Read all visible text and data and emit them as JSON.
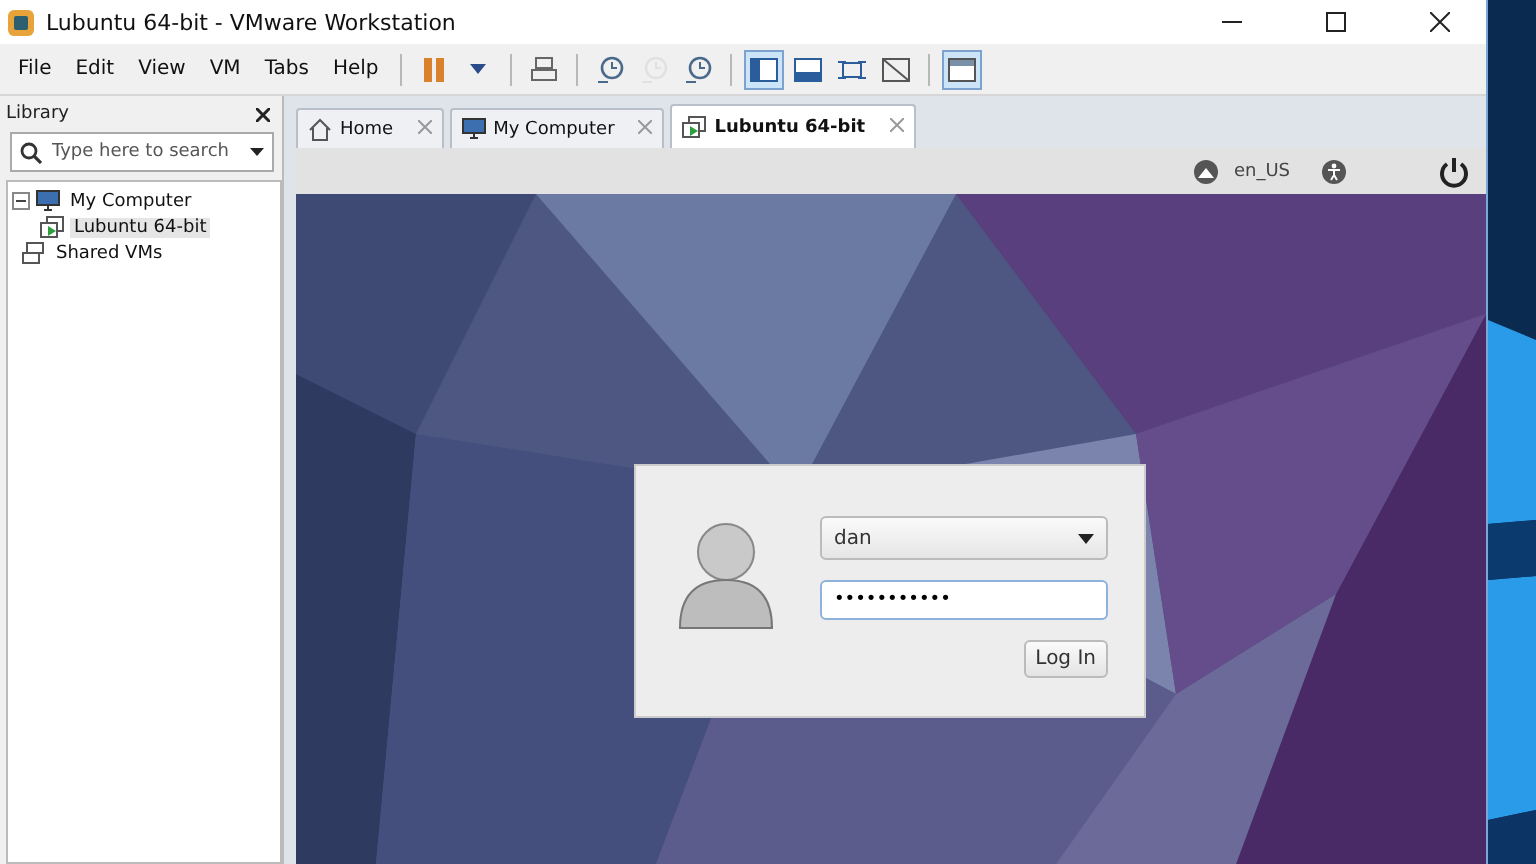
{
  "window": {
    "title": "Lubuntu 64-bit - VMware Workstation"
  },
  "menu": [
    "File",
    "Edit",
    "View",
    "VM",
    "Tabs",
    "Help"
  ],
  "toolbar": [
    {
      "kind": "pause",
      "selected": false,
      "disabled": false
    },
    {
      "kind": "caret",
      "selected": false,
      "disabled": false
    },
    {
      "kind": "keys",
      "selected": false,
      "disabled": false
    },
    {
      "kind": "snapshot",
      "selected": false,
      "disabled": false
    },
    {
      "kind": "revert",
      "selected": false,
      "disabled": true
    },
    {
      "kind": "manager",
      "selected": false,
      "disabled": false
    },
    {
      "kind": "library",
      "selected": true,
      "disabled": false
    },
    {
      "kind": "thumbs",
      "selected": false,
      "disabled": false
    },
    {
      "kind": "fullscreen",
      "selected": false,
      "disabled": false
    },
    {
      "kind": "unity",
      "selected": false,
      "disabled": false
    },
    {
      "kind": "console",
      "selected": true,
      "disabled": false
    }
  ],
  "library": {
    "title": "Library",
    "search": {
      "placeholder": "Type here to search"
    },
    "tree": [
      {
        "label": "My Computer",
        "kind": "computer",
        "expanded": true,
        "selected": false,
        "children": [
          {
            "label": "Lubuntu 64-bit",
            "kind": "vm",
            "selected": true
          }
        ]
      },
      {
        "label": "Shared VMs",
        "kind": "shared",
        "selected": false
      }
    ]
  },
  "tabs": [
    {
      "label": "Home",
      "kind": "home",
      "selected": false
    },
    {
      "label": "My Computer",
      "kind": "computer",
      "selected": false
    },
    {
      "label": "Lubuntu 64-bit",
      "kind": "vm",
      "selected": true
    }
  ],
  "vm_bar": {
    "language": "en_US"
  },
  "login": {
    "user": "dan",
    "password": "•••••••••••",
    "button": "Log In"
  }
}
